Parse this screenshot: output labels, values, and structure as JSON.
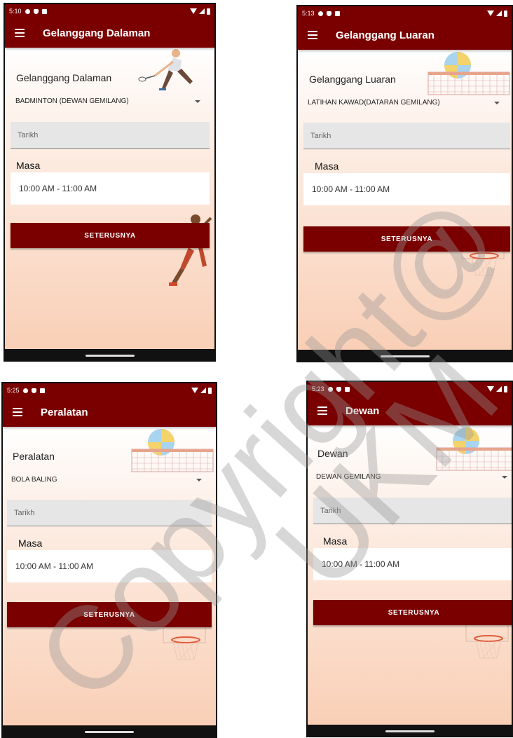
{
  "screens": [
    {
      "status_time": "5:10",
      "app_title": "Gelanggang Dalaman",
      "section_label": "Gelanggang Dalaman",
      "selected_option": "BADMINTON (DEWAN GEMILANG)",
      "date_placeholder": "Tarikh",
      "time_label": "Masa",
      "time_value": "10:00 AM - 11:00 AM",
      "button_label": "SETERUSNYA"
    },
    {
      "status_time": "5:13",
      "app_title": "Gelanggang Luaran",
      "section_label": "Gelanggang Luaran",
      "selected_option": "LATIHAN KAWAD(DATARAN GEMILANG)",
      "date_placeholder": "Tarikh",
      "time_label": "Masa",
      "time_value": "10:00 AM - 11:00 AM",
      "button_label": "SETERUSNYA"
    },
    {
      "status_time": "5:25",
      "app_title": "Peralatan",
      "section_label": "Peralatan",
      "selected_option": "BOLA BALING",
      "date_placeholder": "Tarikh",
      "time_label": "Masa",
      "time_value": "10:00 AM - 11:00 AM",
      "button_label": "SETERUSNYA"
    },
    {
      "status_time": "5:23",
      "app_title": "Dewan",
      "section_label": "Dewan",
      "selected_option": "DEWAN GEMILANG",
      "date_placeholder": "Tarikh",
      "time_label": "Masa",
      "time_value": "10:00 AM - 11:00 AM",
      "button_label": "SETERUSNYA"
    }
  ],
  "watermark": {
    "line1": "Copyright@",
    "line2": "UKM"
  },
  "colors": {
    "brand": "#7a0000",
    "field_bg": "#e6e6e6",
    "gradient_end": "#f9cfb6"
  },
  "icons": [
    "gear-icon",
    "shield-icon",
    "sim-card-icon",
    "wifi-icon",
    "signal-icon",
    "battery-icon",
    "hamburger-menu-icon",
    "dropdown-arrow-icon",
    "badminton-player-illustration",
    "volleyball-net-illustration",
    "basketball-player-illustration",
    "basketball-hoop-illustration"
  ]
}
